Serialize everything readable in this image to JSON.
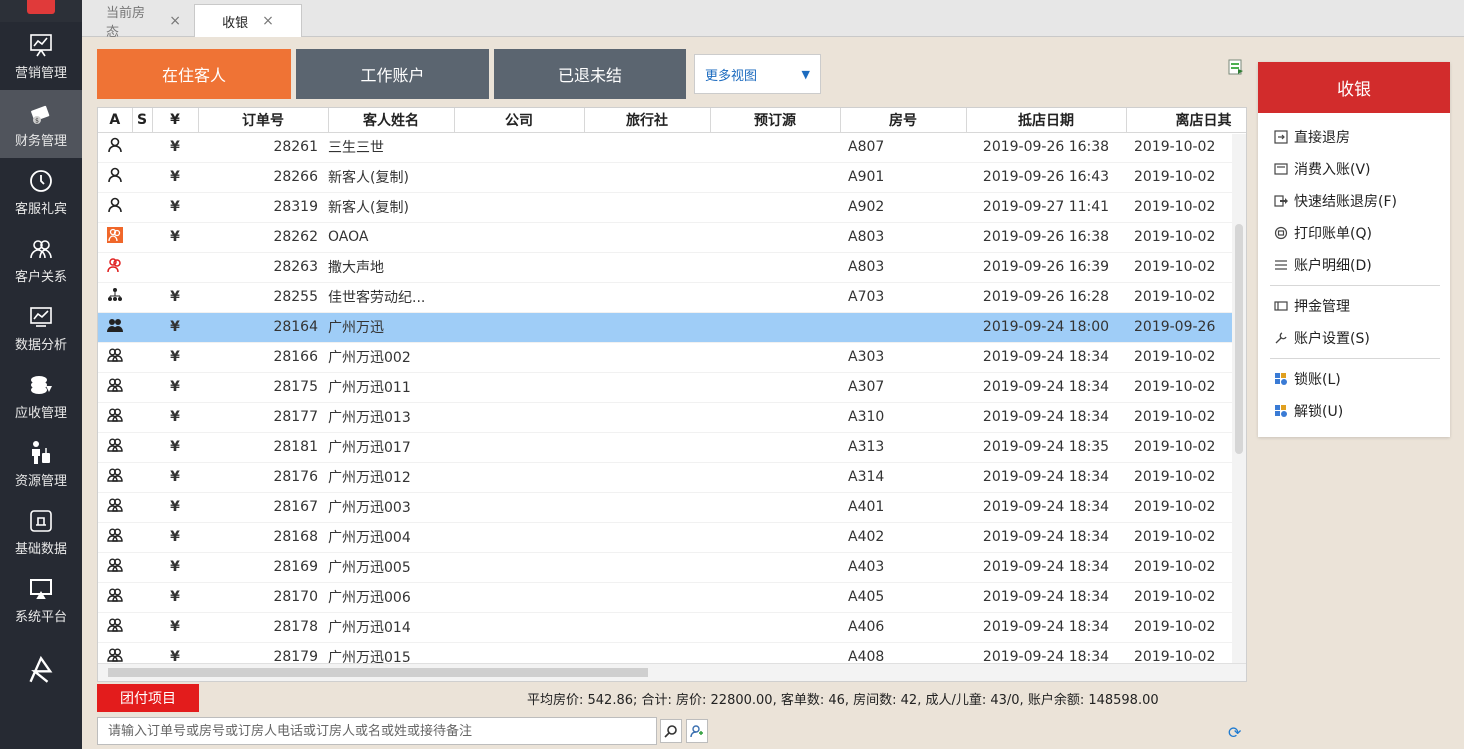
{
  "nav": {
    "items": [
      {
        "label": "营销管理",
        "icon": "presentation-chart-icon"
      },
      {
        "label": "财务管理",
        "icon": "money-icon"
      },
      {
        "label": "客服礼宾",
        "icon": "clock-icon"
      },
      {
        "label": "客户关系",
        "icon": "users-icon"
      },
      {
        "label": "数据分析",
        "icon": "line-chart-icon"
      },
      {
        "label": "应收管理",
        "icon": "coins-icon"
      },
      {
        "label": "资源管理",
        "icon": "luggage-person-icon"
      },
      {
        "label": "基础数据",
        "icon": "database-icon"
      },
      {
        "label": "系统平台",
        "icon": "monitor-icon"
      }
    ]
  },
  "tabs": {
    "tab1": "当前房态",
    "tab2": "收银",
    "close": "×"
  },
  "views": {
    "in_house": "在住客人",
    "work_account": "工作账户",
    "checked_out": "已退未结",
    "more": "更多视图"
  },
  "table": {
    "headers": {
      "a": "A",
      "s": "S",
      "y": "¥",
      "order": "订单号",
      "guest": "客人姓名",
      "company": "公司",
      "agency": "旅行社",
      "source": "预订源",
      "room": "房号",
      "arrive": "抵店日期",
      "depart": "离店日其"
    },
    "rows": [
      {
        "icon": "person-icon",
        "y": "¥",
        "order": "28261",
        "guest": "三生三世",
        "room": "A807",
        "arrive": "2019-09-26 16:38",
        "depart": "2019-10-02"
      },
      {
        "icon": "person-icon",
        "y": "¥",
        "order": "28266",
        "guest": "新客人(复制)",
        "room": "A901",
        "arrive": "2019-09-26 16:43",
        "depart": "2019-10-02"
      },
      {
        "icon": "person-icon",
        "y": "¥",
        "order": "28319",
        "guest": "新客人(复制)",
        "room": "A902",
        "arrive": "2019-09-27 11:41",
        "depart": "2019-10-02"
      },
      {
        "icon": "person-orange-icon",
        "y": "¥",
        "order": "28262",
        "guest": "OAOA",
        "room": "A803",
        "arrive": "2019-09-26 16:38",
        "depart": "2019-10-02"
      },
      {
        "icon": "person-red-icon",
        "y": "",
        "order": "28263",
        "guest": "撒大声地",
        "room": "A803",
        "arrive": "2019-09-26 16:39",
        "depart": "2019-10-02"
      },
      {
        "icon": "org-tree-icon",
        "y": "¥",
        "order": "28255",
        "guest": "佳世客劳动纪...",
        "room": "A703",
        "arrive": "2019-09-26 16:28",
        "depart": "2019-10-02"
      },
      {
        "icon": "group-filled-icon",
        "y": "¥",
        "order": "28164",
        "guest": "广州万迅",
        "room": "",
        "arrive": "2019-09-24 18:00",
        "depart": "2019-09-26",
        "selected": true
      },
      {
        "icon": "group-icon",
        "y": "¥",
        "order": "28166",
        "guest": "广州万迅002",
        "room": "A303",
        "arrive": "2019-09-24 18:34",
        "depart": "2019-10-02"
      },
      {
        "icon": "group-icon",
        "y": "¥",
        "order": "28175",
        "guest": "广州万迅011",
        "room": "A307",
        "arrive": "2019-09-24 18:34",
        "depart": "2019-10-02"
      },
      {
        "icon": "group-icon",
        "y": "¥",
        "order": "28177",
        "guest": "广州万迅013",
        "room": "A310",
        "arrive": "2019-09-24 18:34",
        "depart": "2019-10-02"
      },
      {
        "icon": "group-icon",
        "y": "¥",
        "order": "28181",
        "guest": "广州万迅017",
        "room": "A313",
        "arrive": "2019-09-24 18:35",
        "depart": "2019-10-02"
      },
      {
        "icon": "group-icon",
        "y": "¥",
        "order": "28176",
        "guest": "广州万迅012",
        "room": "A314",
        "arrive": "2019-09-24 18:34",
        "depart": "2019-10-02"
      },
      {
        "icon": "group-icon",
        "y": "¥",
        "order": "28167",
        "guest": "广州万迅003",
        "room": "A401",
        "arrive": "2019-09-24 18:34",
        "depart": "2019-10-02"
      },
      {
        "icon": "group-icon",
        "y": "¥",
        "order": "28168",
        "guest": "广州万迅004",
        "room": "A402",
        "arrive": "2019-09-24 18:34",
        "depart": "2019-10-02"
      },
      {
        "icon": "group-icon",
        "y": "¥",
        "order": "28169",
        "guest": "广州万迅005",
        "room": "A403",
        "arrive": "2019-09-24 18:34",
        "depart": "2019-10-02"
      },
      {
        "icon": "group-icon",
        "y": "¥",
        "order": "28170",
        "guest": "广州万迅006",
        "room": "A405",
        "arrive": "2019-09-24 18:34",
        "depart": "2019-10-02"
      },
      {
        "icon": "group-icon",
        "y": "¥",
        "order": "28178",
        "guest": "广州万迅014",
        "room": "A406",
        "arrive": "2019-09-24 18:34",
        "depart": "2019-10-02"
      },
      {
        "icon": "group-icon",
        "y": "¥",
        "order": "28179",
        "guest": "广州万迅015",
        "room": "A408",
        "arrive": "2019-09-24 18:34",
        "depart": "2019-10-02"
      }
    ]
  },
  "footer": {
    "group_button": "团付项目",
    "summary": "平均房价: 542.86; 合计: 房价: 22800.00, 客单数: 46, 房间数: 42, 成人/儿童: 43/0, 账户余额: 148598.00",
    "search_placeholder": "请输入订单号或房号或订房人电话或订房人或名或姓或接待备注"
  },
  "cashier": {
    "title": "收银",
    "items": [
      {
        "label": "直接退房",
        "icon": "checkout-icon"
      },
      {
        "label": "消费入账(V)",
        "icon": "post-charge-icon"
      },
      {
        "label": "快速结账退房(F)",
        "icon": "quick-checkout-icon"
      },
      {
        "label": "打印账单(Q)",
        "icon": "print-icon"
      },
      {
        "label": "账户明细(D)",
        "icon": "list-icon"
      },
      {
        "label": "押金管理",
        "icon": "card-icon"
      },
      {
        "label": "账户设置(S)",
        "icon": "wrench-icon"
      },
      {
        "label": "锁账(L)",
        "icon": "lock-icon"
      },
      {
        "label": "解锁(U)",
        "icon": "unlock-icon"
      }
    ]
  },
  "colors": {
    "accent_orange": "#ef7335",
    "slate": "#5b6570",
    "cashier_red": "#d22c2c",
    "group_red": "#e31c1c",
    "selected_row": "#9fcdf7"
  }
}
